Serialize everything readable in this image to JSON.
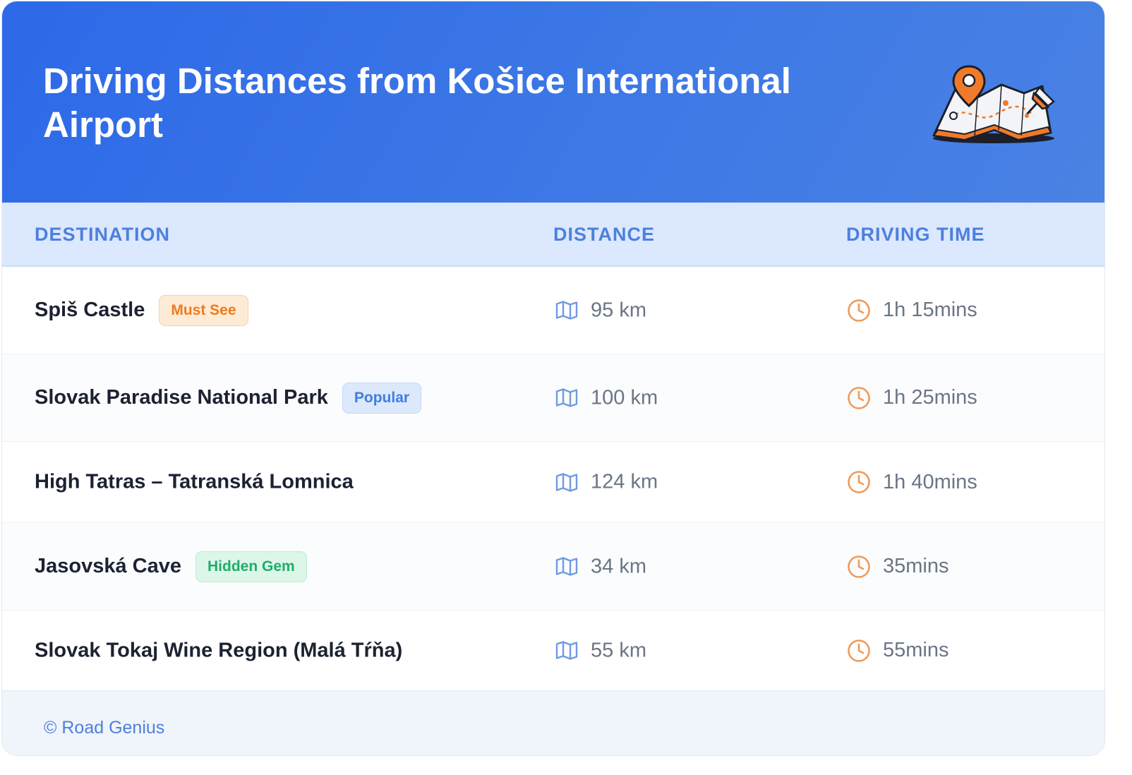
{
  "header": {
    "title": "Driving Distances from Košice International Airport",
    "illustration_icon": "map-pin-illustration"
  },
  "table": {
    "columns": [
      "DESTINATION",
      "DISTANCE",
      "DRIVING TIME"
    ],
    "rows": [
      {
        "destination": "Spiš Castle",
        "badge": "Must See",
        "distance": "95 km",
        "time": "1h 15mins"
      },
      {
        "destination": "Slovak Paradise National Park",
        "badge": "Popular",
        "distance": "100 km",
        "time": "1h 25mins"
      },
      {
        "destination": "High Tatras – Tatranská Lomnica",
        "badge": "",
        "distance": "124 km",
        "time": "1h 40mins"
      },
      {
        "destination": "Jasovská Cave",
        "badge": "Hidden Gem",
        "distance": "34 km",
        "time": "35mins"
      },
      {
        "destination": "Slovak Tokaj Wine Region (Malá Tŕňa)",
        "badge": "",
        "distance": "55 km",
        "time": "55mins"
      }
    ],
    "distance_icon": "map-icon",
    "time_icon": "clock-icon"
  },
  "footer": {
    "text": "© Road Genius"
  },
  "colors": {
    "header": "#2d69e8",
    "column_header_bg": "#dbe8fd",
    "column_header_text": "#4d80de",
    "map_icon": "#6f9ae3",
    "clock_icon": "#ef9a5a",
    "badge_must_see": "#f07a1f",
    "badge_popular": "#3f7de0",
    "badge_hidden_gem": "#1fae6a"
  }
}
